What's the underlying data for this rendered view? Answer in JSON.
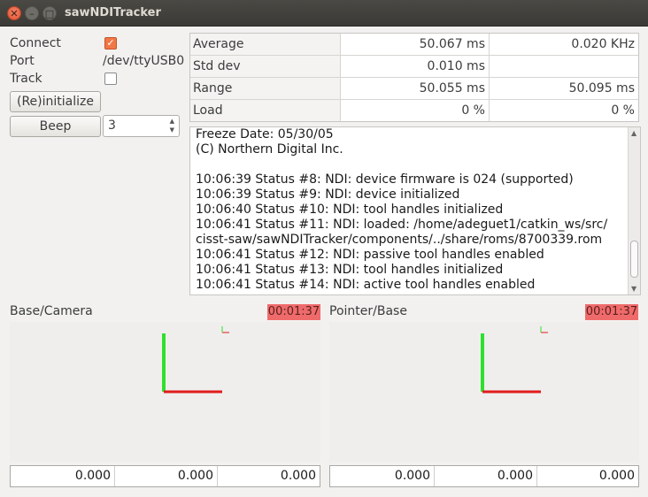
{
  "window": {
    "title": "sawNDITracker"
  },
  "controls": {
    "connect_label": "Connect",
    "connect_checked": true,
    "port_label": "Port",
    "port_value": "/dev/ttyUSB0",
    "track_label": "Track",
    "track_checked": false,
    "reinit_label": "(Re)initialize",
    "beep_label": "Beep",
    "beep_count": "3"
  },
  "stats": {
    "rows": [
      {
        "name": "Average",
        "v1": "50.067 ms",
        "v2": "0.020  KHz"
      },
      {
        "name": "Std dev",
        "v1": "0.010  ms",
        "v2": ""
      },
      {
        "name": "Range",
        "v1": "50.055 ms",
        "v2": "50.095 ms"
      },
      {
        "name": "Load",
        "v1": "0   %",
        "v2": "0   %"
      }
    ]
  },
  "log": {
    "lines": [
      "Freeze Date: 05/30/05",
      "(C) Northern Digital Inc.",
      "",
      "10:06:39 Status #8: NDI: device firmware is 024 (supported)",
      "10:06:39 Status #9: NDI: device initialized",
      "10:06:40 Status #10: NDI: tool handles initialized",
      "10:06:41 Status #11: NDI: loaded: /home/adeguet1/catkin_ws/src/",
      "cisst-saw/sawNDITracker/components/../share/roms/8700339.rom",
      "10:06:41 Status #12: NDI: passive tool handles enabled",
      "10:06:41 Status #13: NDI: tool handles initialized",
      "10:06:41 Status #14: NDI: active tool handles enabled"
    ]
  },
  "panels": {
    "base_camera": {
      "title": "Base/Camera",
      "timer": "00:01:37",
      "x": "0.000",
      "y": "0.000",
      "z": "0.000"
    },
    "pointer_base": {
      "title": "Pointer/Base",
      "timer": "00:01:37",
      "x": "0.000",
      "y": "0.000",
      "z": "0.000"
    }
  },
  "colors": {
    "x_axis": "#e11b1b",
    "y_axis": "#2fe02f",
    "timer_bg": "#ef6b6b",
    "checkbox_on": "#f07746"
  }
}
